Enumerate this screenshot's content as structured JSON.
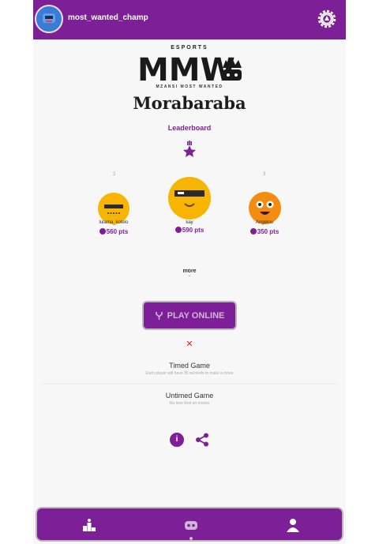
{
  "header": {
    "username": "most_wanted_champ",
    "avatar_icon": "robot-avatar",
    "settings_icon": "gear-icon"
  },
  "brand": {
    "esports": "ESPORTS",
    "logo_text": "MMW",
    "tagline": "MZANSI MOST WANTED",
    "game_title": "Morabaraba"
  },
  "leaderboard": {
    "label": "Leaderboard",
    "players": [
      {
        "rank": "2",
        "name": "lulama_kotelo",
        "points": "560 pts"
      },
      {
        "rank": "1",
        "name": "kay",
        "points": "590 pts"
      },
      {
        "rank": "3",
        "name": "Angelou",
        "points": "350 pts"
      }
    ],
    "more_label": "more"
  },
  "play": {
    "label": "PLAY ONLINE",
    "close": "✕"
  },
  "modes": [
    {
      "title": "Timed Game",
      "desc": "Each player will have 35 seconds to make a move"
    },
    {
      "title": "Untimed Game",
      "desc": "No time limit on moves"
    }
  ],
  "actions": {
    "info_label": "i"
  },
  "bottom_nav": {
    "items": [
      "leaderboard-icon",
      "gamepad-icon",
      "profile-icon"
    ],
    "active_index": 1
  },
  "colors": {
    "primary": "#7d1f97",
    "accent": "#cdb6d8",
    "danger": "#d02424",
    "gold": "#f7b500"
  }
}
